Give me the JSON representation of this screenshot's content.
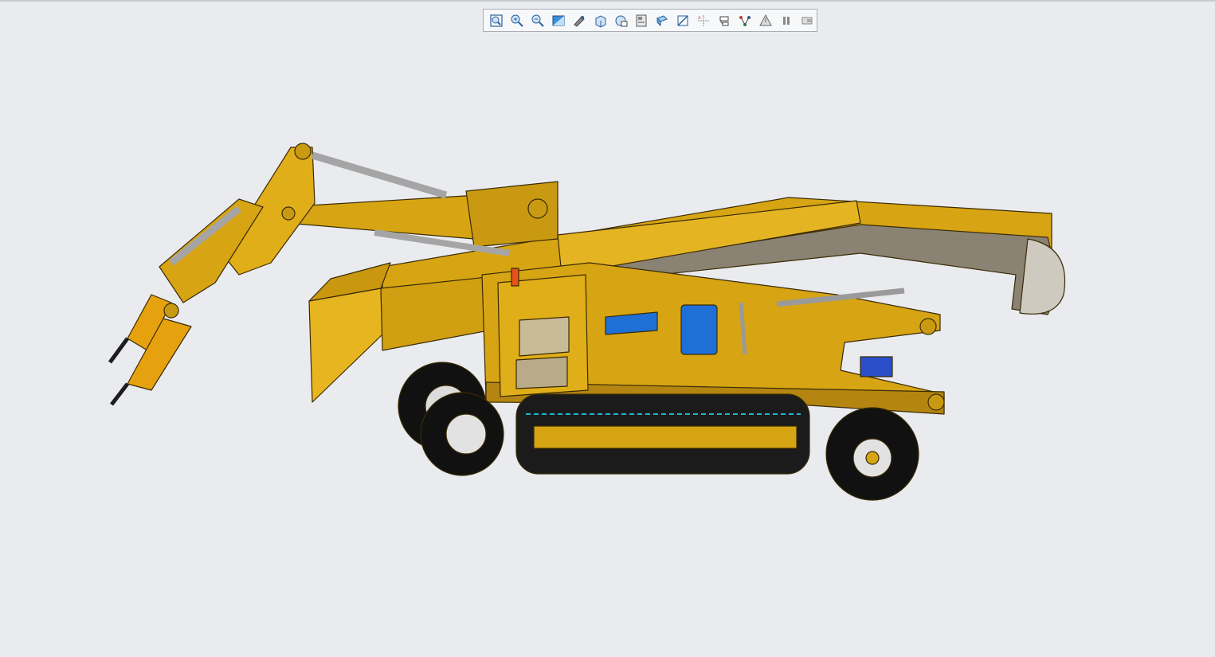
{
  "toolbar": {
    "buttons": [
      {
        "id": "zoom-fit",
        "icon": "zoom-fit-icon"
      },
      {
        "id": "zoom-in",
        "icon": "zoom-in-icon"
      },
      {
        "id": "zoom-out",
        "icon": "zoom-out-icon"
      },
      {
        "id": "repaint",
        "icon": "repaint-icon"
      },
      {
        "id": "display-style",
        "icon": "display-style-icon"
      },
      {
        "id": "saved-orientations",
        "icon": "saved-orientations-icon"
      },
      {
        "id": "view-manager",
        "icon": "view-manager-icon"
      },
      {
        "id": "perspective",
        "icon": "perspective-icon"
      },
      {
        "id": "section",
        "icon": "section-icon"
      },
      {
        "id": "datum-display",
        "icon": "datum-display-icon"
      },
      {
        "id": "annotation-display",
        "icon": "annotation-display-icon"
      },
      {
        "id": "spin-center",
        "icon": "spin-center-icon"
      },
      {
        "id": "sketch-display",
        "icon": "sketch-display-icon"
      },
      {
        "id": "appearance",
        "icon": "appearance-icon"
      },
      {
        "id": "pause",
        "icon": "pause-icon"
      },
      {
        "id": "graphics-options",
        "icon": "graphics-options-icon"
      }
    ]
  },
  "colors": {
    "body_yellow": "#d7a513",
    "body_dark": "#b48510",
    "body_light": "#e8ba2a",
    "track": "#1b1b1b",
    "track_accent": "#22b4d2",
    "motor_blue": "#1e6fd6",
    "cylinder_grey": "#a5a5a5",
    "background": "#e9ebee"
  }
}
